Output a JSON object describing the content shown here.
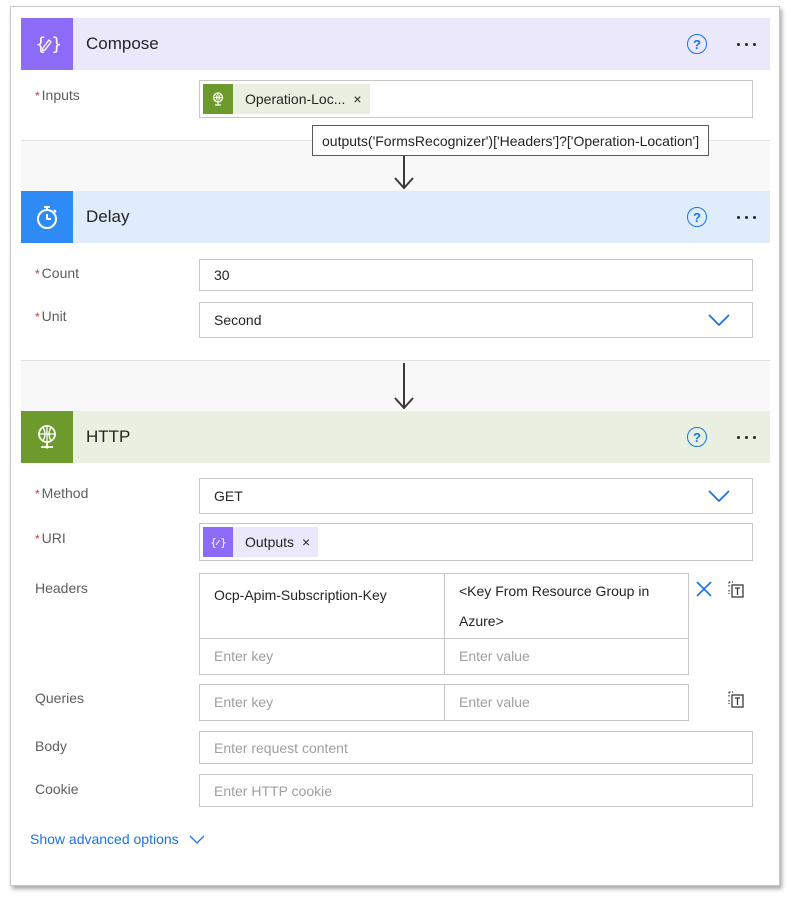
{
  "compose": {
    "title": "Compose",
    "icon": "compose-curly-braces-pencil-icon",
    "color": "#8c6cf7",
    "inputs_label": "Inputs",
    "required_mark": "*",
    "token_label": "Operation-Loc...",
    "token_close": "×",
    "token_icon": "http-globe-icon",
    "tooltip": "outputs('FormsRecognizer')['Headers']?['Operation-Location']",
    "help": "?"
  },
  "delay": {
    "title": "Delay",
    "icon": "stopwatch-icon",
    "color": "#2e8af5",
    "count_label": "Count",
    "count_value": "30",
    "unit_label": "Unit",
    "unit_value": "Second",
    "required_mark": "*",
    "help": "?"
  },
  "http": {
    "title": "HTTP",
    "icon": "http-globe-icon",
    "color": "#6c9a2c",
    "help": "?",
    "required_mark": "*",
    "method_label": "Method",
    "method_value": "GET",
    "uri_label": "URI",
    "uri_token_label": "Outputs",
    "uri_token_close": "×",
    "headers_label": "Headers",
    "headers": [
      {
        "key": "Ocp-Apim-Subscription-Key",
        "value": "<Key From Resource Group in Azure>"
      },
      {
        "key_placeholder": "Enter key",
        "value_placeholder": "Enter value"
      }
    ],
    "queries_label": "Queries",
    "queries": [
      {
        "key_placeholder": "Enter key",
        "value_placeholder": "Enter value"
      }
    ],
    "body_label": "Body",
    "body_placeholder": "Enter request content",
    "cookie_label": "Cookie",
    "cookie_placeholder": "Enter HTTP cookie",
    "advanced_label": "Show advanced options"
  },
  "colors": {
    "accent": "#1a73e8",
    "required": "#d13438"
  }
}
